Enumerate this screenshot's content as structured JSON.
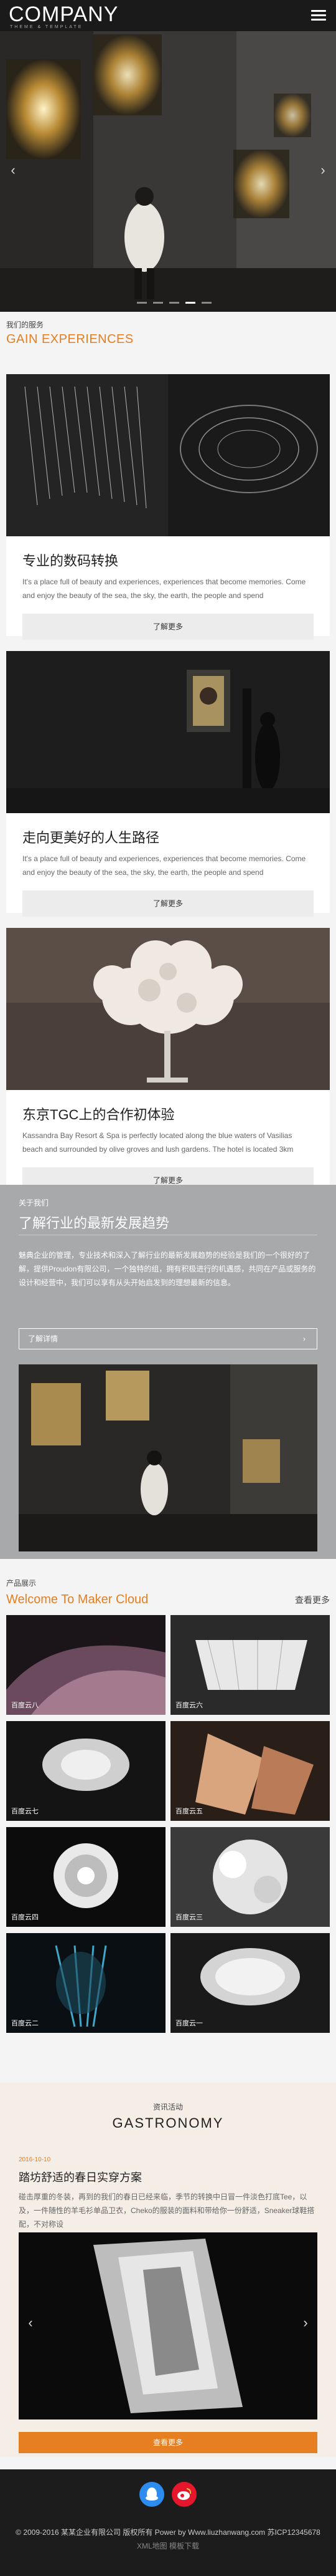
{
  "header": {
    "logo": "COMPANY",
    "logo_sub": "THEME & TEMPLATE"
  },
  "hero": {
    "prev": "‹",
    "next": "›",
    "slides": 5,
    "active": 4
  },
  "gain": {
    "label": "我们的服务",
    "title": "GAIN EXPERIENCES",
    "cards": [
      {
        "title": "专业的数码转换",
        "text": "It's a place full of beauty and experiences, experiences that become memories. Come and enjoy the beauty of the sea, the sky, the earth, the people and spend",
        "button": "了解更多"
      },
      {
        "title": "走向更美好的人生路径",
        "text": "It's a place full of beauty and experiences, experiences that become memories. Come and enjoy the beauty of the sea, the sky, the earth, the people and spend",
        "button": "了解更多"
      },
      {
        "title": "东京TGC上的合作初体验",
        "text": "Kassandra Bay Resort & Spa is perfectly located along the blue waters of Vasilias beach and surrounded by olive groves and lush gardens. The hotel is located 3km",
        "button": "了解更多"
      }
    ]
  },
  "about": {
    "label": "关于我们",
    "title": "了解行业的最新发展趋势",
    "text": "魅典企业的管理，专业技术和深入了解行业的最新发展趋势的经验是我们的一个很好的了解，提供Proudon有限公司，一个独特的组，拥有积极进行的机遇感，共同在产品或服务的设计和经营中，我们可以享有从头开始启发到的理想最新的信息。",
    "more": "了解详情",
    "more_icon": "›"
  },
  "products": {
    "label": "产品展示",
    "title": "Welcome To Maker Cloud",
    "more": "查看更多",
    "items": [
      "百度云八",
      "百度云六",
      "百度云七",
      "百度云五",
      "百度云四",
      "百度云三",
      "百度云二",
      "百度云一"
    ]
  },
  "news": {
    "label": "资讯活动",
    "title": "GASTRONOMY",
    "date": "2016-10-10",
    "headline": "踏坊舒适的春日实穿方案",
    "text": "碰击厚重的冬装，再到的我们的春日已经来临，季节的转换中日冒一件淡色打底Tee，以及，一件随性的羊毛衫单品卫衣，Cheko的服装的面料和带给你一份舒适，Sneaker球鞋搭配，不对称设",
    "prev": "‹",
    "next": "›",
    "button": "查看更多"
  },
  "footer": {
    "copyright": "© 2009-2016 某某企业有限公司 版权所有 Power by Www.liuzhanwang.com 苏ICP12345678",
    "links": "XML地图    模板下载"
  },
  "colors": {
    "accent": "#e67e22",
    "qq": "#2d8cf0",
    "weibo": "#e6162d"
  }
}
